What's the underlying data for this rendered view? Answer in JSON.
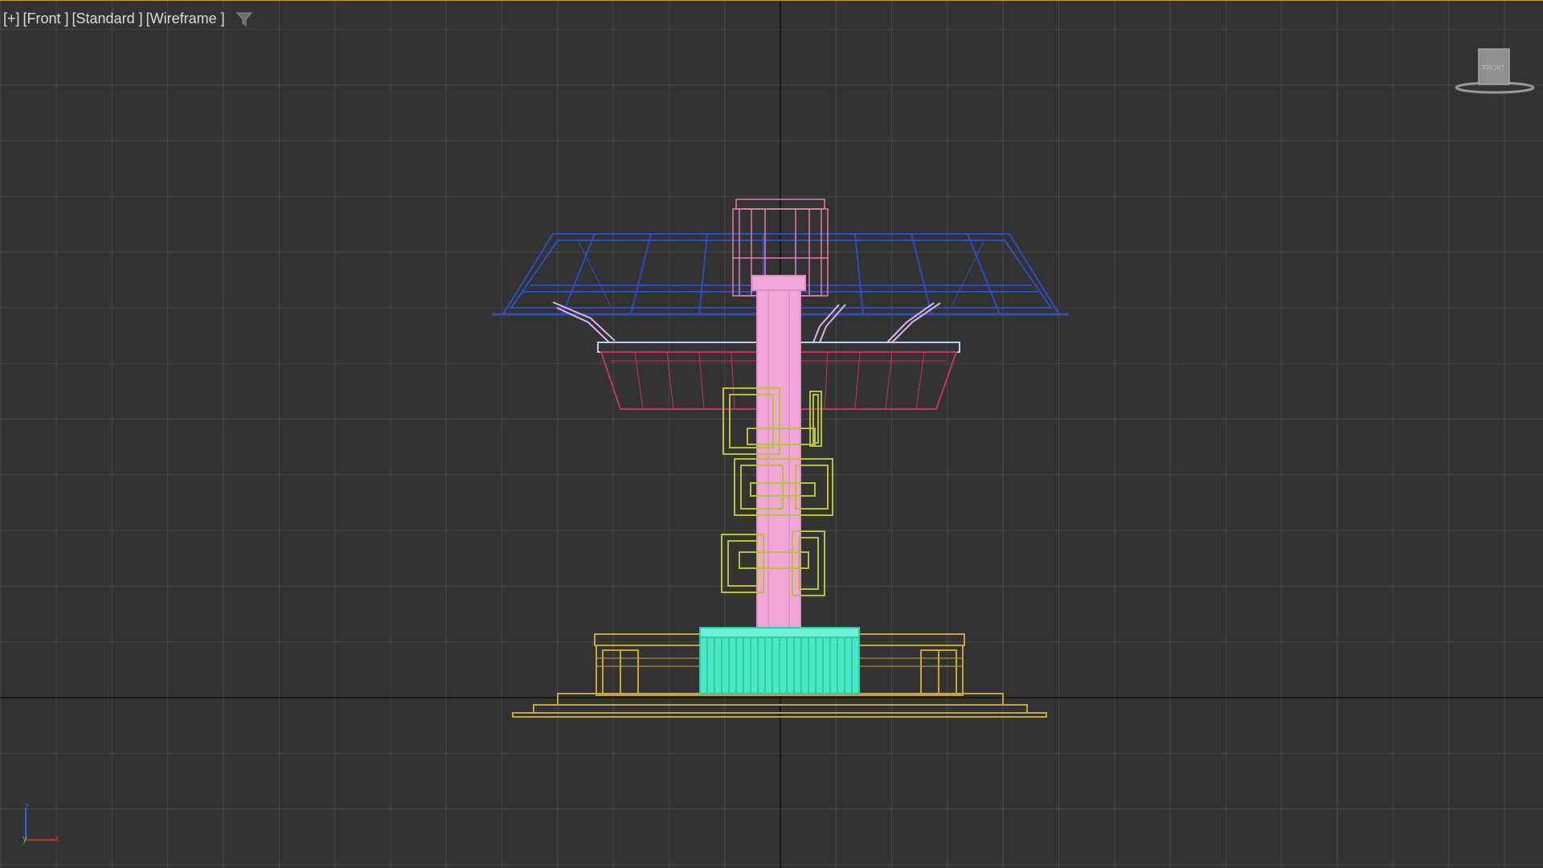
{
  "viewport": {
    "labels": {
      "plus": "[+]",
      "view": "[Front ]",
      "shading_preset": "[Standard ]",
      "shading_mode": "[Wireframe ]"
    },
    "filter_icon": "funnel-filter-icon",
    "viewcube_face": "FRONT",
    "axis_labels": {
      "z": "z",
      "y": "y",
      "x": "x"
    },
    "colors": {
      "background": "#333333",
      "grid": "#484848",
      "world_axes": "#111111",
      "active_border": "#c9a227",
      "canopy_frame": "#2b4fc2",
      "top_cap": "#e17fb0",
      "pillar": "#f0a6d6",
      "lower_ring_rim": "#b8d0ee",
      "lower_ring_body": "#c8306a",
      "boxes": "#b6c23a",
      "base": "#c4a63a",
      "base_center": "#47e8c6"
    }
  }
}
